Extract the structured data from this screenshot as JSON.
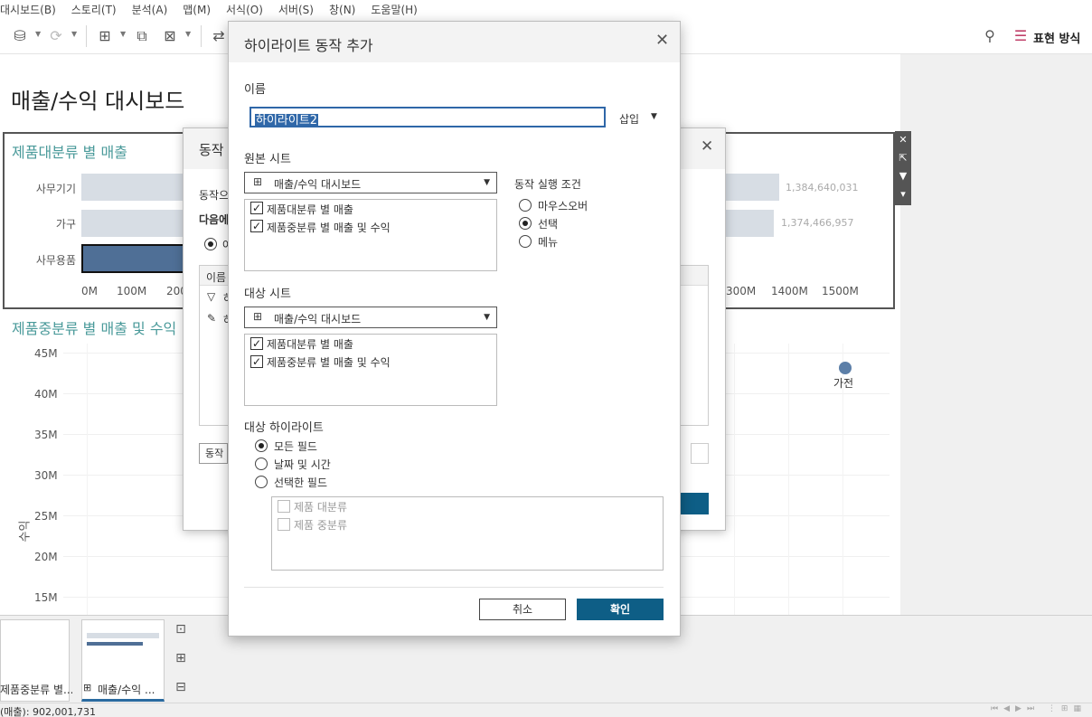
{
  "menu": [
    "대시보드(B)",
    "스토리(T)",
    "분석(A)",
    "맵(M)",
    "서식(O)",
    "서버(S)",
    "창(N)",
    "도움말(H)"
  ],
  "toolbar": {
    "format_label": "표현 방식"
  },
  "dashboard": {
    "title": "매출/수익 대시보드",
    "bar_chart": {
      "title": "제품대분류 별 매출",
      "categories": [
        "사무기기",
        "가구",
        "사무용품"
      ],
      "values": [
        1384640031,
        1374466957,
        902001731
      ],
      "value_labels": [
        "1,384,640,031",
        "1,374,466,957"
      ],
      "x_ticks": [
        "0M",
        "100M",
        "200",
        "300M",
        "1400M",
        "1500M"
      ],
      "selected": "사무용품"
    },
    "scatter": {
      "title": "제품중분류 별 매출 및 수익",
      "y_ticks": [
        "45M",
        "40M",
        "35M",
        "30M",
        "25M",
        "20M",
        "15M"
      ],
      "ylabel": "수익",
      "point_label": "가전"
    }
  },
  "chart_data": [
    {
      "type": "bar",
      "title": "제품대분류 별 매출",
      "categories": [
        "사무기기",
        "가구",
        "사무용품"
      ],
      "values": [
        1384640031,
        1374466957,
        902001731
      ],
      "xlabel": "",
      "ylabel": "",
      "xlim": [
        0,
        1500000000
      ]
    },
    {
      "type": "scatter",
      "title": "제품중분류 별 매출 및 수익",
      "ylabel": "수익",
      "y_ticks": [
        "15M",
        "20M",
        "25M",
        "30M",
        "35M",
        "40M",
        "45M"
      ],
      "points": [
        {
          "label": "가전",
          "y": 43000000
        }
      ]
    }
  ],
  "sheets": {
    "tab1": "제품중분류 별...",
    "tab2": "매출/수익 ..."
  },
  "status": {
    "text": "(매출): 902,001,731"
  },
  "bg_dialog": {
    "title": "동작",
    "line1": "동작으",
    "line2": "다음에",
    "radio": "여",
    "col_header": "이름",
    "row1": "하",
    "row2": "하",
    "btn": "동작"
  },
  "dialog": {
    "title": "하이라이트 동작 추가",
    "name_label": "이름",
    "name_value": "하이라이트2",
    "insert_label": "삽입",
    "source_label": "원본 시트",
    "source_select": "매출/수익 대시보드",
    "source_items": [
      "제품대분류 별 매출",
      "제품중분류 별 매출 및 수익"
    ],
    "condition_label": "동작 실행 조건",
    "conditions": [
      "마우스오버",
      "선택",
      "메뉴"
    ],
    "target_label": "대상 시트",
    "target_select": "매출/수익 대시보드",
    "target_items": [
      "제품대분류 별 매출",
      "제품중분류 별 매출 및 수익"
    ],
    "highlight_label": "대상 하이라이트",
    "highlight_options": [
      "모든 필드",
      "날짜 및 시간",
      "선택한 필드"
    ],
    "field_items": [
      "제품 대분류",
      "제품 중분류"
    ],
    "cancel": "취소",
    "ok": "확인"
  }
}
